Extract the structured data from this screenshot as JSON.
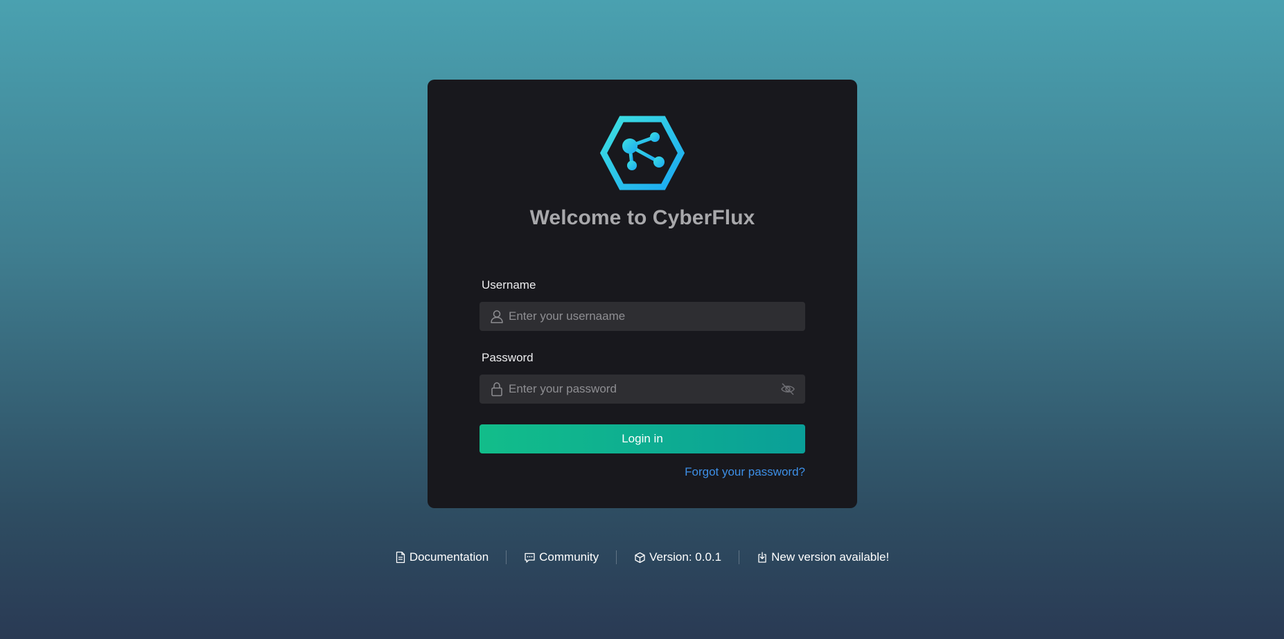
{
  "login": {
    "title": "Welcome to CyberFlux",
    "username_label": "Username",
    "username_placeholder": "Enter your usernaame",
    "password_label": "Password",
    "password_placeholder": "Enter your password",
    "submit_label": "Login in",
    "forgot_label": "Forgot your password?"
  },
  "footer": {
    "items": [
      {
        "label": "Documentation",
        "icon": "document-icon"
      },
      {
        "label": "Community",
        "icon": "chat-icon"
      },
      {
        "label": "Version: 0.0.1",
        "icon": "package-icon"
      },
      {
        "label": "New version available!",
        "icon": "download-icon"
      }
    ]
  },
  "colors": {
    "card_background": "#18181d",
    "accent_green": "#12bd8a",
    "accent_teal": "#0a9f98",
    "link_blue": "#3d8fe6",
    "logo_cyan": "#29c6f0"
  }
}
